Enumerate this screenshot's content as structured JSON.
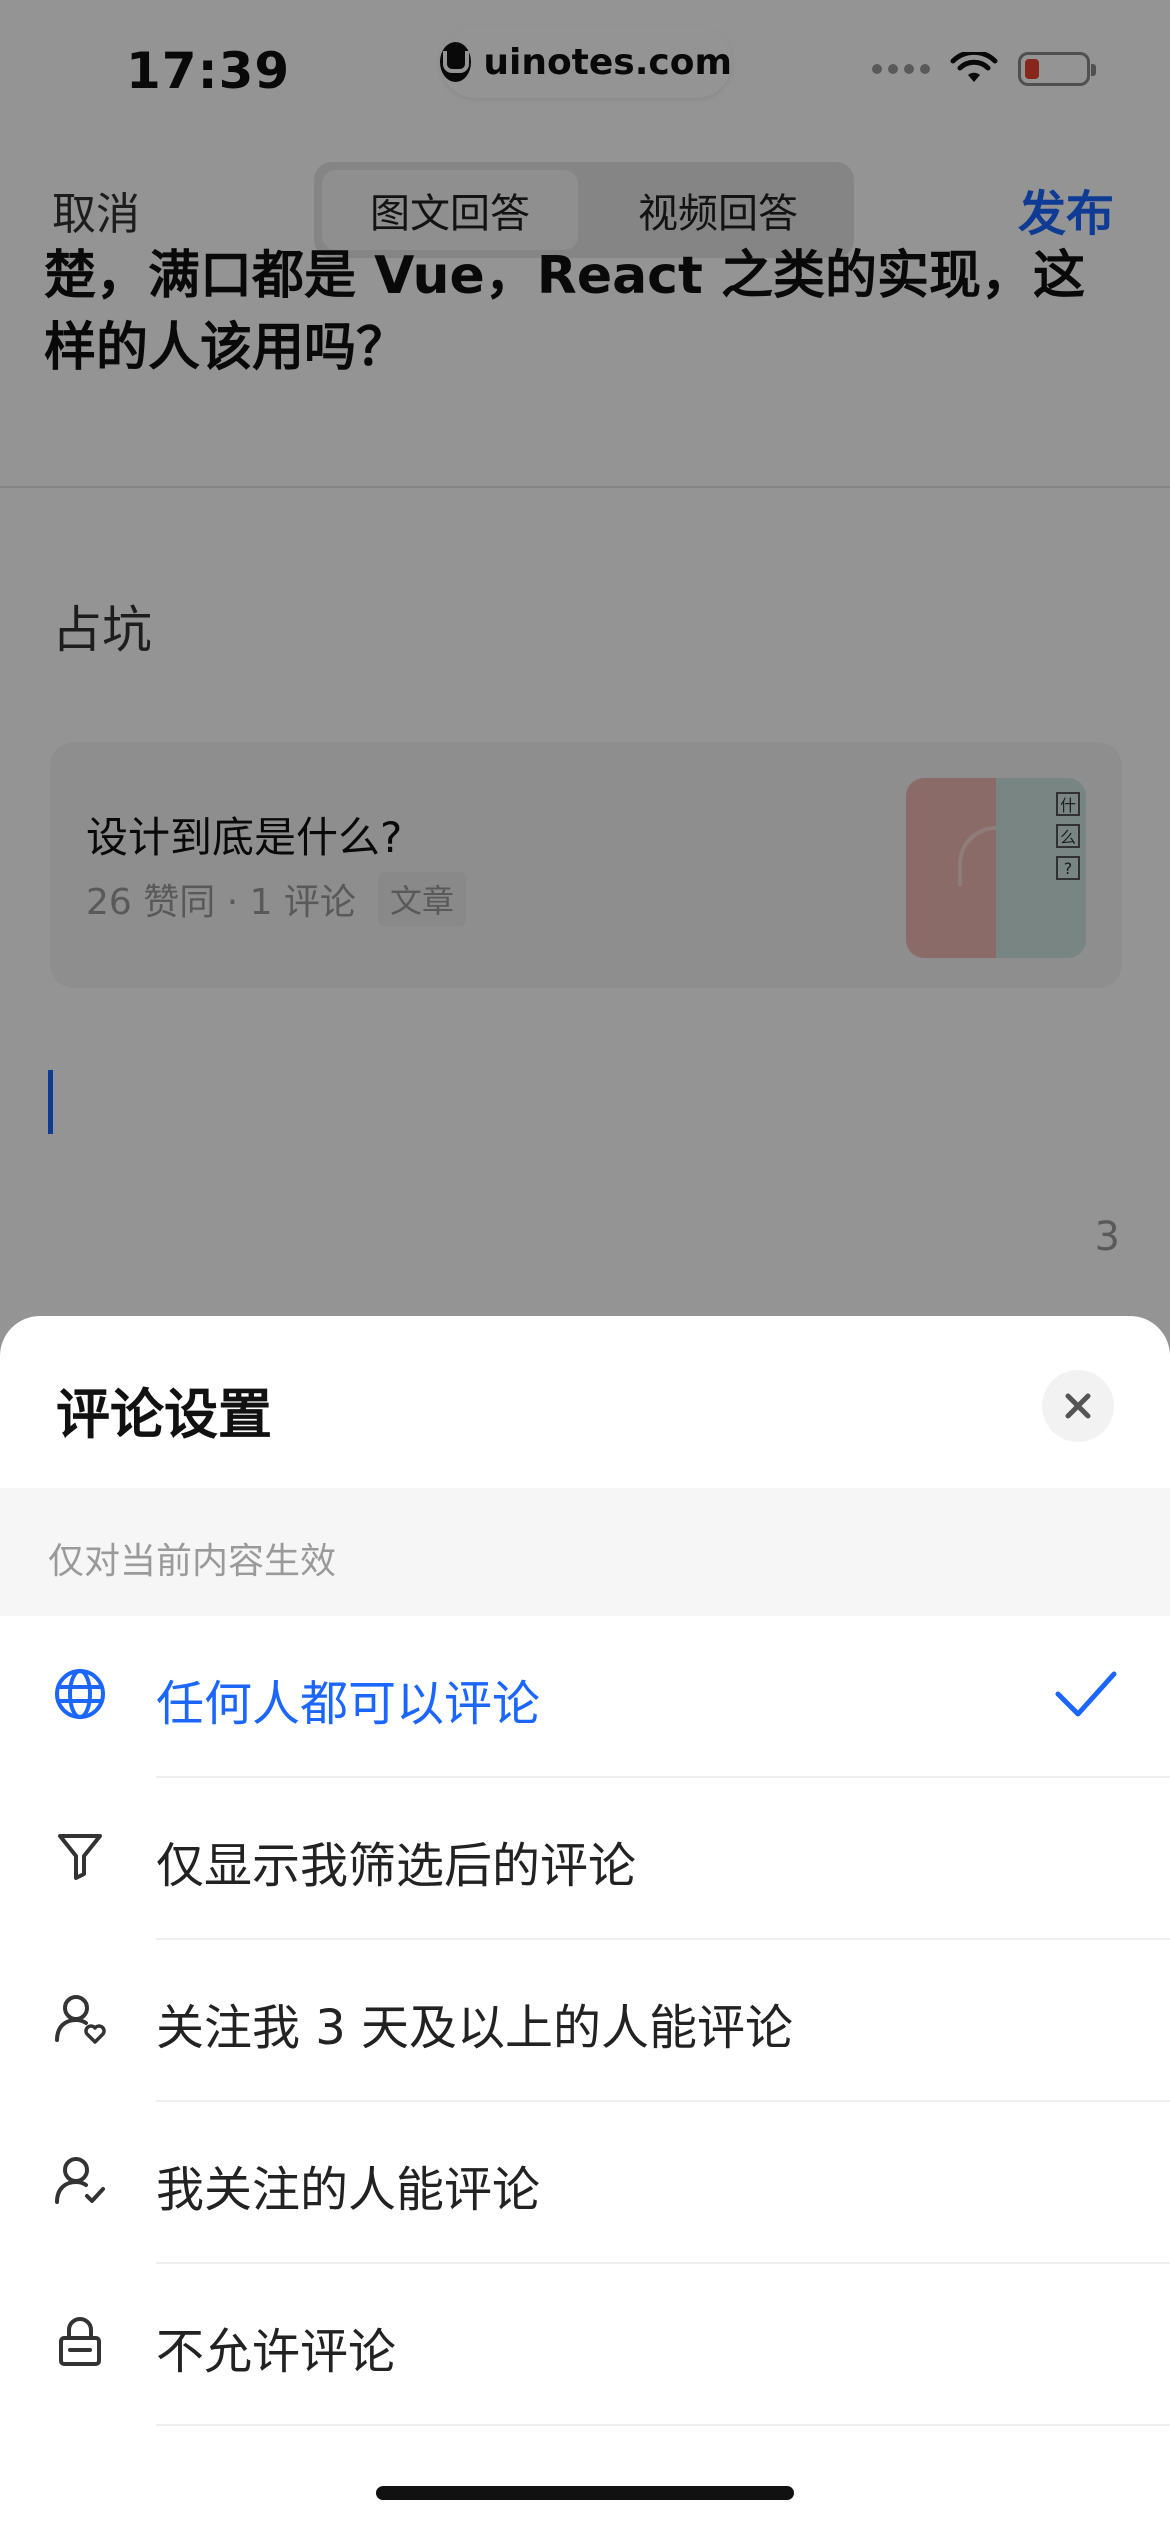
{
  "status": {
    "time": "17:39",
    "watermark": "uinotes.com",
    "battery_color": "#e8432e"
  },
  "nav": {
    "cancel": "取消",
    "tabs": [
      {
        "label": "图文回答",
        "active": true
      },
      {
        "label": "视频回答",
        "active": false
      }
    ],
    "publish": "发布",
    "accent": "#1a66ff"
  },
  "question": {
    "text": "楚，满口都是 Vue，React 之类的实现，这样的人该用吗？"
  },
  "answer": {
    "text": "占坑",
    "card": {
      "title": "设计到底是什么?",
      "meta": "26 赞同 · 1 评论",
      "tag": "文章"
    },
    "char_count": "3"
  },
  "sheet": {
    "title": "评论设置",
    "hint": "仅对当前内容生效",
    "options": [
      {
        "label": "任何人都可以评论",
        "icon": "globe-icon",
        "selected": true
      },
      {
        "label": "仅显示我筛选后的评论",
        "icon": "filter-icon",
        "selected": false
      },
      {
        "label": "关注我 3 天及以上的人能评论",
        "icon": "user-heart-icon",
        "selected": false
      },
      {
        "label": "我关注的人能评论",
        "icon": "user-check-icon",
        "selected": false
      },
      {
        "label": "不允许评论",
        "icon": "lock-icon",
        "selected": false
      }
    ]
  }
}
